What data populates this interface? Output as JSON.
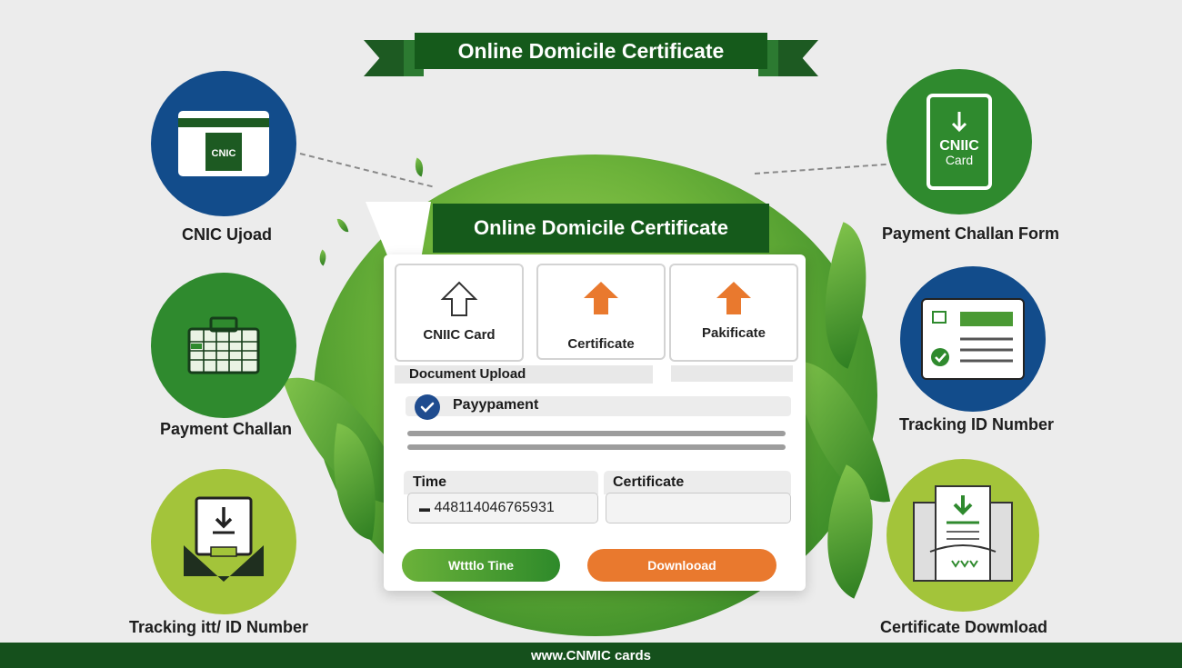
{
  "header": {
    "ribbon_title": "Online Domicile Certificate"
  },
  "panel": {
    "title": "Online Domicile Certificate",
    "cards": [
      {
        "label": "CNIIC Card",
        "icon": "upload-outline-icon"
      },
      {
        "label": "Certificate",
        "icon": "upload-orange-icon"
      },
      {
        "label": "Pakificate",
        "icon": "upload-orange-icon"
      }
    ],
    "document_upload_label": "Document Upload",
    "payment_label": "Payypament",
    "time_label": "Time",
    "time_value": "4481140467659​31",
    "certificate_label": "Certificate",
    "certificate_value": "",
    "primary_button": "Wtttlo Tine",
    "download_button": "Downlooad"
  },
  "features_left": [
    {
      "label": "CNIC Ujoad",
      "icon": "id-card-icon",
      "card_text": "CNIC",
      "color": "#124c8b"
    },
    {
      "label": "Payment Challan",
      "icon": "calendar-icon",
      "color": "#2f8a2e"
    },
    {
      "label": "Tracking itt/ ID Number",
      "icon": "download-tray-icon",
      "color": "#a3c43a"
    }
  ],
  "features_right": [
    {
      "label": "Payment Challan Form",
      "icon": "cnic-card-download-icon",
      "card_text_1": "CNIIC",
      "card_text_2": "Card",
      "color": "#2f8a2e"
    },
    {
      "label": "Tracking ID Number",
      "icon": "id-check-icon",
      "color": "#124c8b"
    },
    {
      "label": "Certificate Dowmload",
      "icon": "certificate-download-icon",
      "color": "#a3c43a"
    }
  ],
  "footer": {
    "text": "www.CNMIC cards"
  }
}
